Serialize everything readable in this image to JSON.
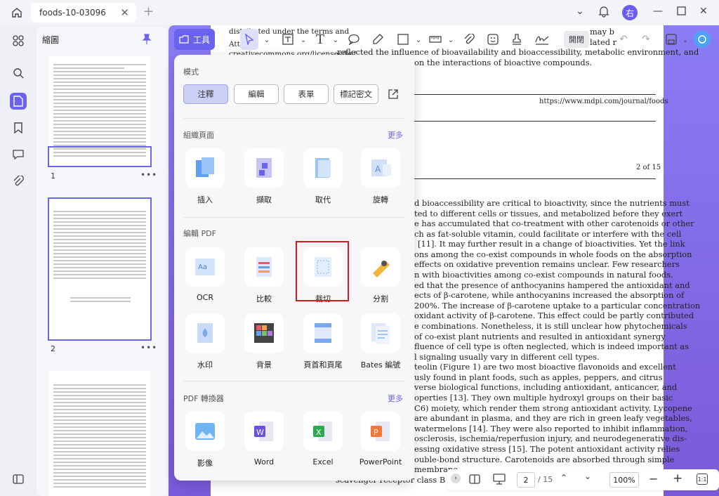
{
  "window": {
    "tab_title": "foods-10-03096",
    "avatar_letter": "右"
  },
  "sidebar": {
    "title": "縮圖",
    "pages": [
      "1",
      "2"
    ]
  },
  "toolbar": {
    "tools_label": "工具",
    "open_label": "開閉"
  },
  "menu": {
    "mode_title": "模式",
    "modes": [
      "注釋",
      "編輯",
      "表單",
      "標記密文"
    ],
    "organize_title": "組織頁面",
    "more1": "更多",
    "organize": [
      "插入",
      "擷取",
      "取代",
      "旋轉"
    ],
    "edit_title": "編輯 PDF",
    "edit_row1": [
      "OCR",
      "比較",
      "裁切",
      "分割"
    ],
    "edit_row2": [
      "水印",
      "背景",
      "頁首和頁尾",
      "Bates 編號"
    ],
    "convert_title": "PDF 轉換器",
    "more2": "更多",
    "convert": [
      "影像",
      "Word",
      "Excel",
      "PowerPoint"
    ]
  },
  "document": {
    "header_frag": [
      "distributed under the terms and",
      "Att",
      "creativecommons.org/licenses/by/"
    ],
    "abstract_frag": [
      "may b",
      "lated r",
      "reflected the influence of bioavailability and bioaccessibility, metabolic environment, and",
      "on the interactions of bioactive compounds."
    ],
    "url": "https://www.mdpi.com/journal/foods",
    "page_label": "2 of 15",
    "body_lines": [
      "d bioaccessibility are critical to bioactivity, since the nutrients must",
      "ted to different cells or tissues, and metabolized before they exert",
      "e has accumulated that co-treatment with other carotenoids or other",
      "ch as fat-soluble vitamin, could facilitate or interfere with the cell",
      "[11]. It may further result in a change of bioactivities. Yet the link",
      "ons among the co-exist compounds in whole foods on the absorption",
      "effects on oxidative prevention remains unclear.  Few researchers",
      "n with bioactivities among co-exist compounds in natural foods.",
      "ed that the presence of anthocyanins hampered the antioxidant and",
      "ects of β-carotene, while anthocyanins increased the absorption of",
      "200%. The increase of β-carotene uptake to a particular concentration",
      "oxidant activity of β-carotene. This effect could be partly contributed",
      "e combinations. Nonetheless, it is still unclear how phytochemicals",
      "of co-exist plant nutrients and resulted in antioxidant synergy",
      "fluence of cell type is often neglected, which is indeed important as",
      "l signaling usually vary in different cell types.",
      "teolin (Figure 1) are two most bioactive flavonoids and excellent",
      "usly found in plant foods, such as apples, peppers, and citrus",
      "verse biological functions, including antioxidant, anticancer, and",
      "operties [13]. They own multiple hydroxyl groups on their basic",
      "C6) moiety, which render them strong antioxidant activity. Lycopene",
      "are abundant in plasma, and they are rich in green leafy vegetables,",
      "watermelons [14]. They were also reported to inhibit inflammation,",
      "osclerosis, ischemia/reperfusion injury, and neurodegenerative dis-",
      "essing oxidative stress [15]. The potent antioxidant activity relies",
      "ouble-bond structure. Carotenoids are absorbed through simple",
      "membrane",
      "scavenger receptor class B type"
    ]
  },
  "bottombar": {
    "current_page": "2",
    "total_pages": "/ 15",
    "zoom": "100%"
  },
  "colors": {
    "accent": "#6a63f0",
    "highlight": "#d9181c"
  }
}
